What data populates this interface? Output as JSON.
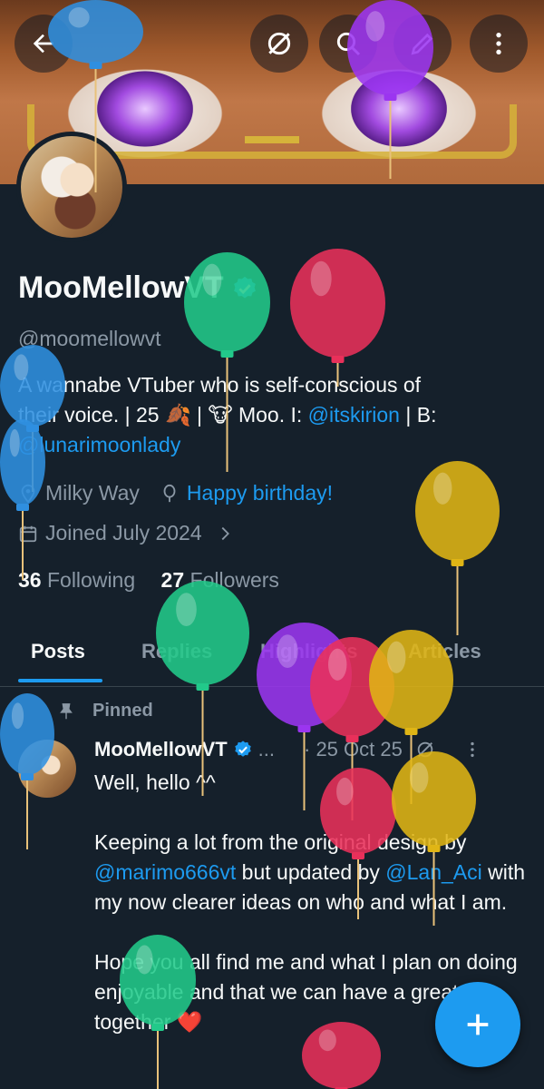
{
  "header": {
    "back_icon": "arrow-left-icon",
    "grok_icon": "slash-circle-icon",
    "search_icon": "search-icon",
    "compose_icon": "pen-icon",
    "more_icon": "more-vertical-icon"
  },
  "profile": {
    "display_name": "MooMellowVT",
    "verified": true,
    "handle": "@moomellowvt",
    "bio_line1": "A wannabe VTuber who is self-conscious of",
    "bio_line2a": "their voice. | 25 🍂 | 🐮 Moo. I: ",
    "bio_link1": "@itskirion",
    "bio_line2b": " | B:",
    "bio_link2": "@lunarimoonlady",
    "location": "Milky Way",
    "birthday": "Happy birthday!",
    "joined": "Joined July 2024",
    "following_count": "36",
    "following_label": "Following",
    "followers_count": "27",
    "followers_label": "Followers"
  },
  "tabs": [
    {
      "label": "Posts",
      "active": true
    },
    {
      "label": "Replies",
      "active": false
    },
    {
      "label": "Highlights",
      "active": false
    },
    {
      "label": "Articles",
      "active": false
    }
  ],
  "pinned_post": {
    "pinned_label": "Pinned",
    "author": "MooMellowVT",
    "ellipsis": "...",
    "date": "· 25 Oct 25",
    "text_p1": "Well, hello ^^",
    "text_p2a": "Keeping a lot from the original design by ",
    "mention1": "@marimo666vt",
    "text_p2b": " but updated by ",
    "mention2": "@Lan_Aci",
    "text_p2c": " with my now clearer ideas on who and what I am.",
    "text_p3": "Hope you all find me and what I plan on doing enjoyable and that we can have a great time together ❤️"
  },
  "fab": {
    "icon": "plus-icon"
  },
  "colors": {
    "background": "#15202b",
    "accent": "#1d9bf0",
    "muted": "#8b98a5",
    "balloon_blue": "#2f8fe0",
    "balloon_purple": "#9b35f0",
    "balloon_green": "#22c98a",
    "balloon_red": "#e9305a",
    "balloon_yellow": "#e0b515"
  }
}
